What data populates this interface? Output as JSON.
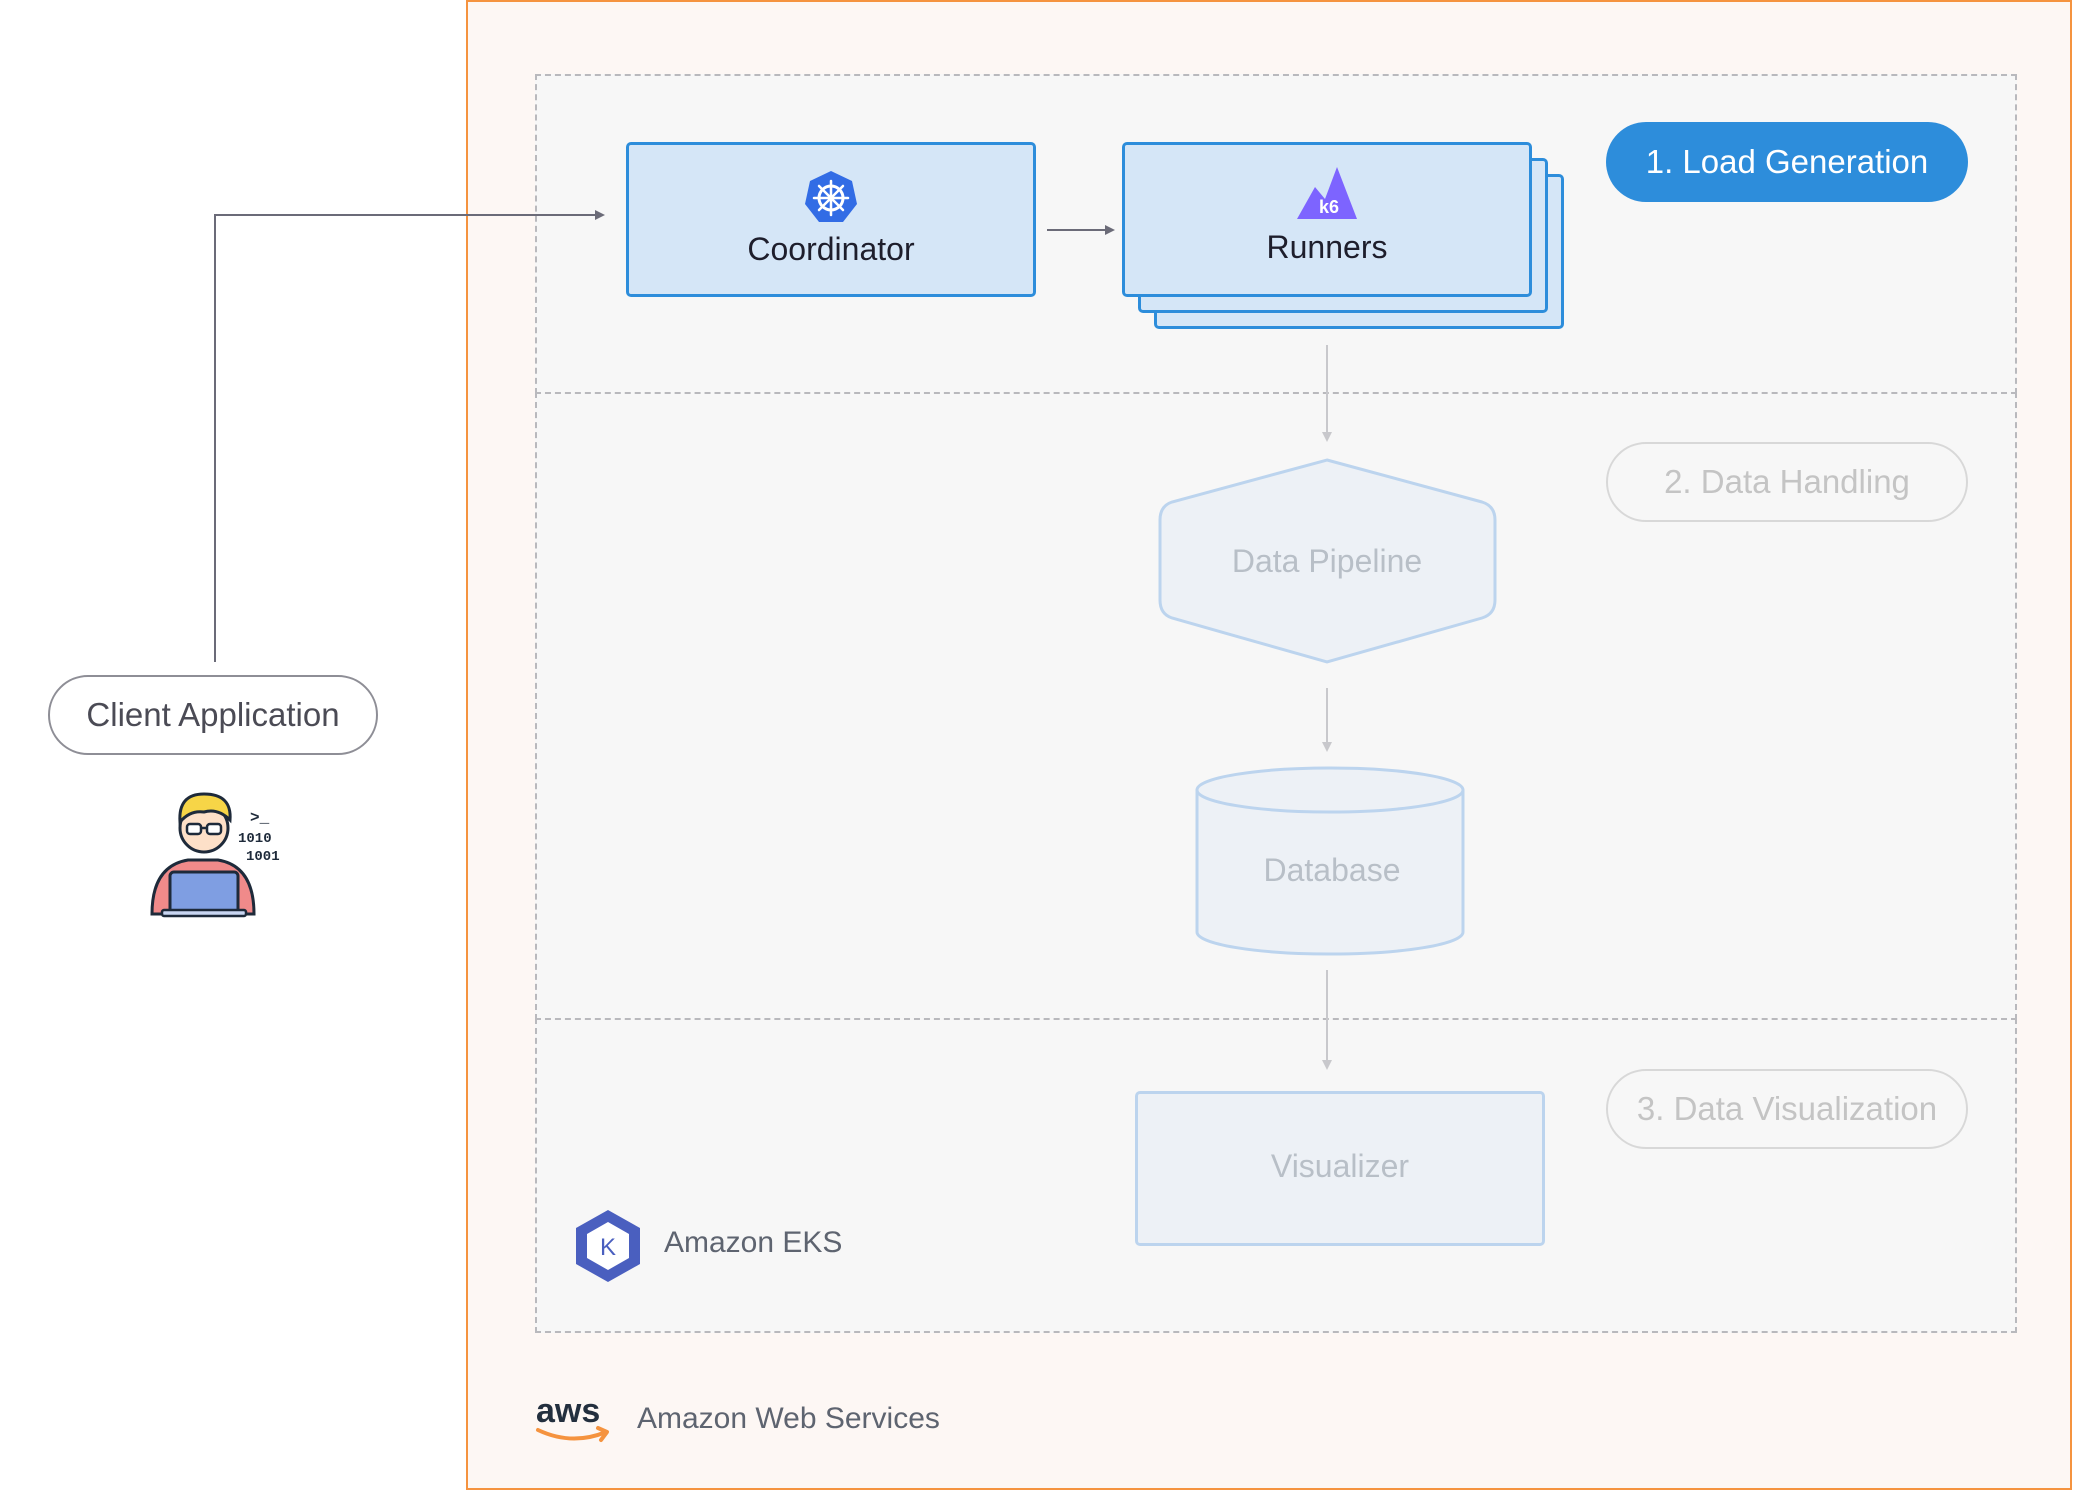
{
  "diagram": {
    "stages": {
      "load_generation": "1. Load Generation",
      "data_handling": "2. Data Handling",
      "data_visualization": "3. Data Visualization"
    },
    "nodes": {
      "coordinator": "Coordinator",
      "runners": "Runners",
      "data_pipeline": "Data Pipeline",
      "database": "Database",
      "visualizer": "Visualizer",
      "client_application": "Client Application"
    },
    "logos": {
      "coordinator_icon": "kubernetes-icon",
      "runners_icon": "k6-icon",
      "runners_icon_text": "k6",
      "eks_icon": "amazon-eks-icon",
      "eks_icon_text": "K",
      "aws_logo": "aws-logo",
      "aws_logo_text": "aws",
      "client_icon": "developer-laptop-icon",
      "client_icon_text": [
        ">_",
        "1010",
        "1001"
      ]
    },
    "containers": {
      "eks": "Amazon EKS",
      "aws": "Amazon Web Services"
    },
    "colors": {
      "aws_border": "#f5933f",
      "active_blue": "#2d8ddb",
      "active_fill": "#d5e6f7",
      "faded_border": "#bcd4ee",
      "faded_fill": "#edf1f6",
      "faded_text": "#b8bfc7",
      "k6_purple": "#7d64ff",
      "eks_blue": "#4a5fbf"
    }
  }
}
